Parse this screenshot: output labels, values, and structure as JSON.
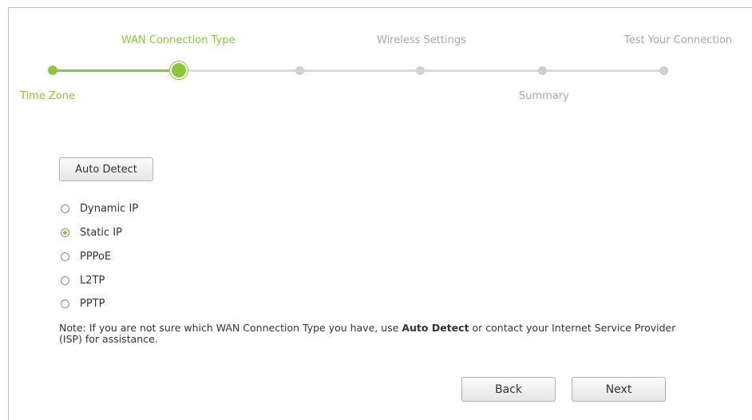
{
  "wizard": {
    "steps_top": [
      "WAN Connection Type",
      "Wireless Settings",
      "Test Your Connection"
    ],
    "steps_bottom": [
      "Time Zone",
      "Summary"
    ],
    "current_step": "WAN Connection Type",
    "accent_color": "#8cc63f",
    "inactive_color": "#d0d0d0"
  },
  "auto_detect_label": "Auto Detect",
  "connection_types": [
    {
      "label": "Dynamic IP",
      "selected": false
    },
    {
      "label": "Static IP",
      "selected": true
    },
    {
      "label": "PPPoE",
      "selected": false
    },
    {
      "label": "L2TP",
      "selected": false
    },
    {
      "label": "PPTP",
      "selected": false
    }
  ],
  "note": {
    "prefix": "Note: If you are not sure which WAN Connection Type you have, use ",
    "bold": "Auto Detect",
    "suffix": " or contact your Internet Service Provider (ISP) for assistance."
  },
  "buttons": {
    "back": "Back",
    "next": "Next"
  }
}
